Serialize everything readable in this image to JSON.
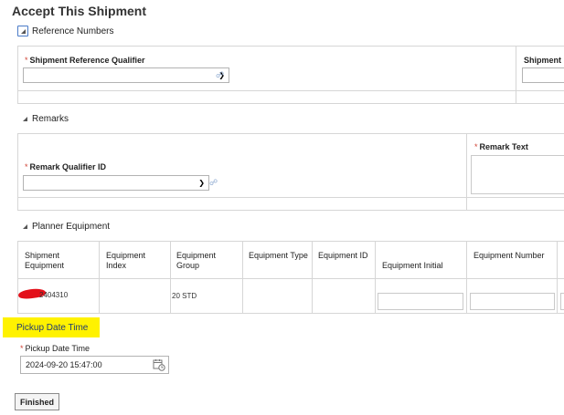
{
  "page": {
    "title": "Accept This Shipment"
  },
  "reference_numbers": {
    "section_title": "Reference Numbers",
    "qualifier_label": "Shipment Reference Qualifier",
    "qualifier_value": "",
    "second_label": "Shipment"
  },
  "remarks": {
    "section_title": "Remarks",
    "qualifier_label": "Remark Qualifier ID",
    "qualifier_value": "",
    "text_label": "Remark Text",
    "text_value": ""
  },
  "planner_equipment": {
    "section_title": "Planner Equipment",
    "columns": [
      "Shipment Equipment",
      "Equipment Index",
      "Equipment Group",
      "Equipment Type",
      "Equipment ID",
      "Equipment Initial",
      "Equipment Number"
    ],
    "rows": [
      {
        "shipment_equipment": "2404310",
        "equipment_index": "",
        "equipment_group": "20 STD",
        "equipment_type": "",
        "equipment_id": "",
        "equipment_initial": "",
        "equipment_number": ""
      }
    ]
  },
  "pickup": {
    "section_title": "Pickup Date Time",
    "field_label": "Pickup Date Time",
    "field_value": "2024-09-20 15:47:00"
  },
  "actions": {
    "finished_label": "Finished"
  },
  "icons": {
    "link": "link-icon",
    "calendar": "calendar-clock-icon",
    "expand": "collapse-triangle-icon"
  },
  "colors": {
    "highlight": "#fff200",
    "required": "#d04437",
    "redaction": "#e3101a"
  }
}
